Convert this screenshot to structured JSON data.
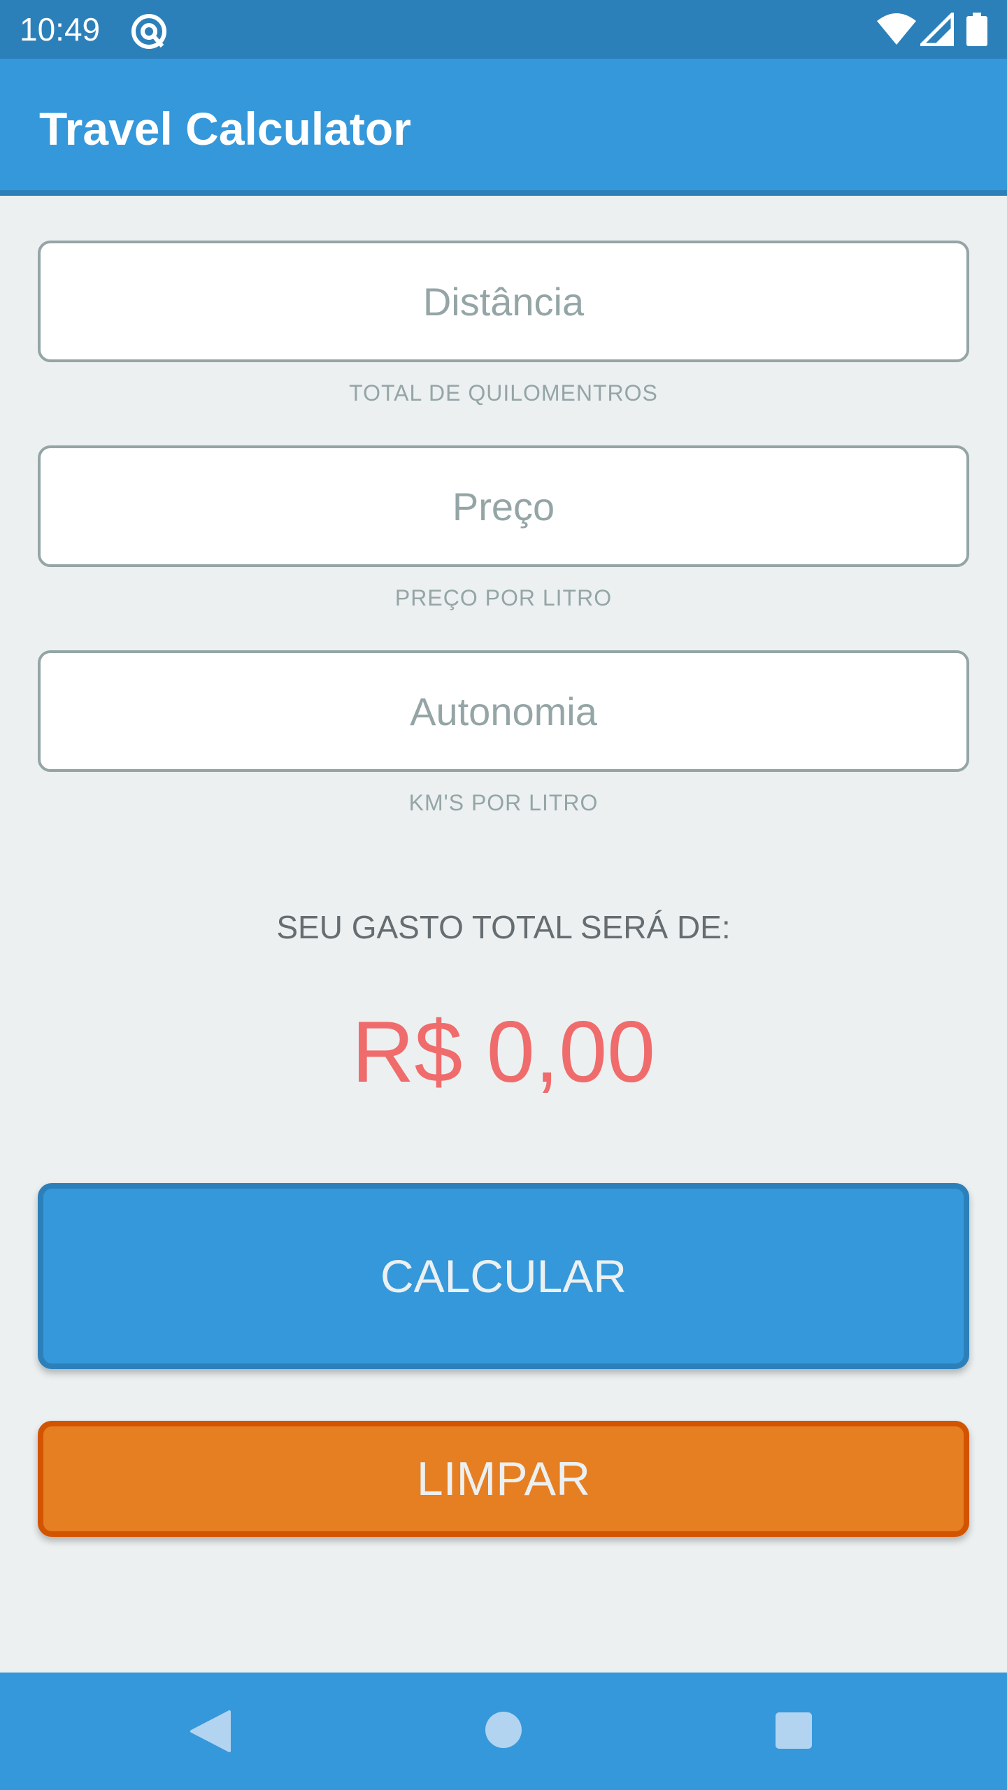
{
  "status_bar": {
    "time": "10:49",
    "icons": [
      "at-sign-icon",
      "wifi-icon",
      "signal-icon",
      "battery-icon"
    ]
  },
  "app_bar": {
    "title": "Travel Calculator"
  },
  "form": {
    "distance": {
      "placeholder": "Distância",
      "value": "",
      "caption": "TOTAL DE QUILOMENTROS"
    },
    "price": {
      "placeholder": "Preço",
      "value": "",
      "caption": "PREÇO POR LITRO"
    },
    "autonomy": {
      "placeholder": "Autonomia",
      "value": "",
      "caption": "KM'S POR LITRO"
    }
  },
  "result": {
    "label": "SEU GASTO TOTAL SERÁ DE:",
    "value": "R$ 0,00"
  },
  "buttons": {
    "calculate": "CALCULAR",
    "clear": "LIMPAR"
  },
  "nav_bar": {
    "icons": [
      "back-icon",
      "home-icon",
      "recents-icon"
    ]
  },
  "colors": {
    "primary": "#3498db",
    "primary_dark": "#2c80ba",
    "accent_orange": "#e67e22",
    "result_red": "#f06b6b",
    "background": "#ecf0f1"
  }
}
